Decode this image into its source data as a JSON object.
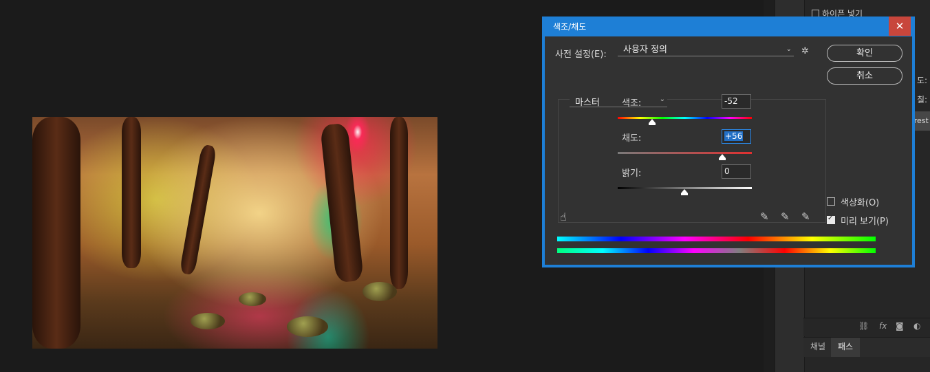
{
  "dialog": {
    "title": "색조/채도",
    "close_label": "✕",
    "preset_label": "사전 설정(E):",
    "preset_value": "사용자 정의",
    "ok_label": "확인",
    "cancel_label": "취소",
    "channel_value": "마스터",
    "hue_label": "색조:",
    "hue_value": "-52",
    "saturation_label": "채도:",
    "saturation_value": "+56",
    "lightness_label": "밝기:",
    "lightness_value": "0",
    "colorize_label": "색상화(O)",
    "colorize_checked": false,
    "preview_label": "미리 보기(P)",
    "preview_checked": true
  },
  "right_panel": {
    "top_checkbox_label": "하이픈 넣기",
    "opacity_label": "도:",
    "fill_label": "칠:",
    "layer_name": "orest",
    "tabs": [
      {
        "label": "채널",
        "active": false
      },
      {
        "label": "패스",
        "active": true
      }
    ],
    "footer_icons": [
      "link-icon",
      "fx-icon",
      "mask-icon",
      "adjustment-icon"
    ]
  },
  "colors": {
    "dialog_accent": "#1e7fd6",
    "close_red": "#c8463c",
    "selection_blue": "#2370c6"
  }
}
